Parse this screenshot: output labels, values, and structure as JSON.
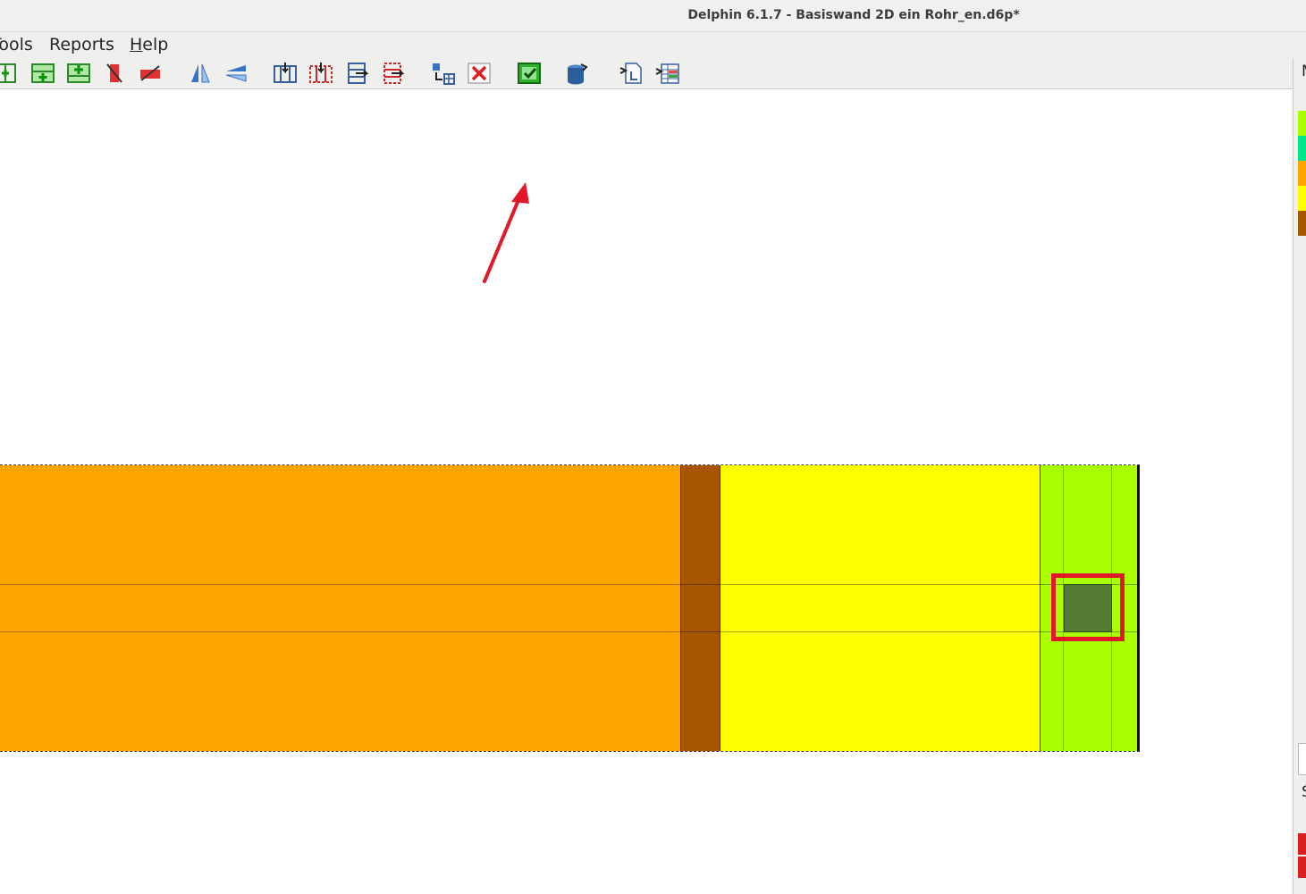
{
  "window": {
    "title": "Delphin 6.1.7 - Basiswand 2D ein Rohr_en.d6p*"
  },
  "menu": {
    "tools": "Tools",
    "reports": "Reports",
    "help": "Help"
  },
  "toolbar": {
    "icons": [
      "insert-column-icon",
      "insert-row-icon",
      "insert-row-center-icon",
      "delete-column-icon",
      "delete-row-icon",
      "mirror-vertical-icon",
      "mirror-horizontal-icon",
      "split-columns-icon",
      "merge-columns-icon",
      "split-rows-icon",
      "merge-rows-icon",
      "grid-assign-icon",
      "delete-assignment-icon",
      "assign-material-icon",
      "database-icon",
      "export-icon",
      "import-table-icon"
    ]
  },
  "right_panel": {
    "top_letter": "M",
    "bottom_letter": "S"
  },
  "colors": {
    "material_orange": "#ffa500",
    "material_brown": "#a85500",
    "material_yellow": "#ffff00",
    "material_green": "#aaff00",
    "pipe": "#537a33",
    "highlight": "#e0182a"
  }
}
